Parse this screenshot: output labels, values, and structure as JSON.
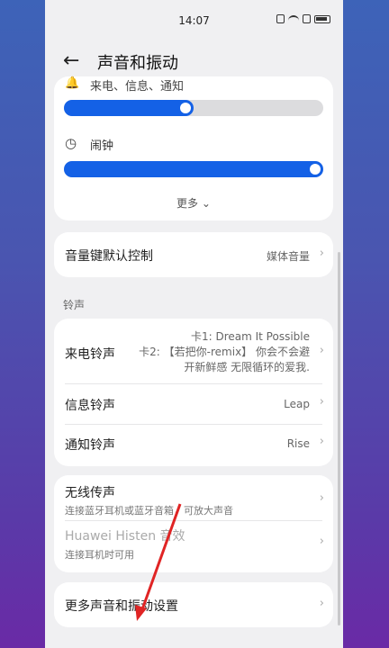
{
  "status": {
    "time": "14:07"
  },
  "header": {
    "title": "声音和振动",
    "back_icon": "back-arrow-icon"
  },
  "volume": {
    "call_label": "来电、信息、通知",
    "call_level": 0.5,
    "alarm_label": "闹钟",
    "alarm_level": 1.0,
    "more_label": "更多"
  },
  "volume_key": {
    "label": "音量键默认控制",
    "value": "媒体音量"
  },
  "ringtones": {
    "section_label": "铃声",
    "call": {
      "label": "来电铃声",
      "line1": "卡1: Dream It Possible",
      "line2": "卡2: 【若把你-remix】 你会不会避",
      "line3": "开新鲜感 无限循环的爱我."
    },
    "message": {
      "label": "信息铃声",
      "value": "Leap"
    },
    "notification": {
      "label": "通知铃声",
      "value": "Rise"
    }
  },
  "wireless": {
    "title": "无线传声",
    "subtitle": "连接蓝牙耳机或蓝牙音箱，可放大声音",
    "histen_title": "Huawei Histen 音效",
    "histen_subtitle": "连接耳机时可用"
  },
  "more_settings": {
    "label": "更多声音和振动设置"
  },
  "colors": {
    "accent": "#1461e6",
    "annotation": "#e02424"
  }
}
